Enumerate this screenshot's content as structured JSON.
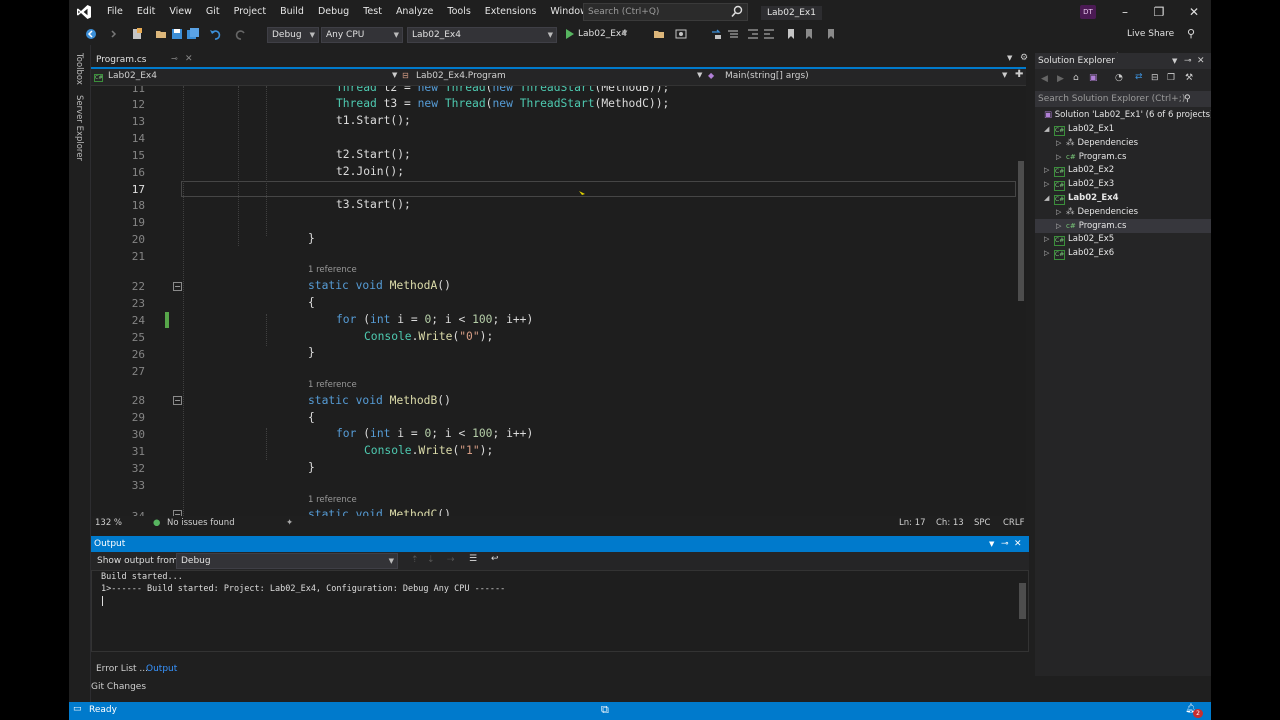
{
  "menu": [
    "File",
    "Edit",
    "View",
    "Git",
    "Project",
    "Build",
    "Debug",
    "Test",
    "Analyze",
    "Tools",
    "Extensions",
    "Window",
    "Help"
  ],
  "search": {
    "placeholder": "Search (Ctrl+Q)"
  },
  "solution_name": "Lab02_Ex1",
  "user_initials": "DT",
  "toolbar": {
    "config": "Debug",
    "platform": "Any CPU",
    "project": "Lab02_Ex4",
    "run_target": "Lab02_Ex4",
    "live_share": "Live Share"
  },
  "left_strip": {
    "toolbox": "Toolbox",
    "server_explorer": "Server Explorer"
  },
  "editor": {
    "tab": "Program.cs",
    "nav_project": "Lab02_Ex4",
    "nav_class": "Lab02_Ex4.Program",
    "nav_member": "Main(string[] args)",
    "reference_label": "1 reference",
    "line_numbers": [
      "11",
      "12",
      "13",
      "14",
      "15",
      "16",
      "17",
      "18",
      "19",
      "20",
      "21",
      "22",
      "23",
      "24",
      "25",
      "26",
      "27",
      "28",
      "29",
      "30",
      "31",
      "32",
      "33",
      "34"
    ],
    "zoom": "132 %",
    "issues": "No issues found",
    "position_line": "Ln: 17",
    "position_char": "Ch: 13",
    "insert_mode": "SPC",
    "line_ending": "CRLF"
  },
  "solution_explorer": {
    "title": "Solution Explorer",
    "search_placeholder": "Search Solution Explorer (Ctrl+;)",
    "solution": "Solution 'Lab02_Ex1' (6 of 6 projects)",
    "items": [
      {
        "label": "Lab02_Ex1"
      },
      {
        "label": "Dependencies"
      },
      {
        "label": "Program.cs"
      },
      {
        "label": "Lab02_Ex2"
      },
      {
        "label": "Lab02_Ex3"
      },
      {
        "label": "Lab02_Ex4"
      },
      {
        "label": "Dependencies"
      },
      {
        "label": "Program.cs"
      },
      {
        "label": "Lab02_Ex5"
      },
      {
        "label": "Lab02_Ex6"
      }
    ]
  },
  "output": {
    "title": "Output",
    "show_from_label": "Show output from:",
    "source": "Debug",
    "lines": [
      "Build started...",
      "1>------ Build started: Project: Lab02_Ex4, Configuration: Debug Any CPU ------"
    ]
  },
  "bottom_tabs": {
    "error_list": "Error List ...",
    "output": "Output",
    "git_changes": "Git Changes"
  },
  "status": {
    "ready": "Ready",
    "notifications": "2"
  },
  "colors": {
    "accent": "#007acc",
    "keyword": "#569cd6",
    "type": "#4ec9b0",
    "string": "#d69d85",
    "number": "#b5cea8"
  }
}
